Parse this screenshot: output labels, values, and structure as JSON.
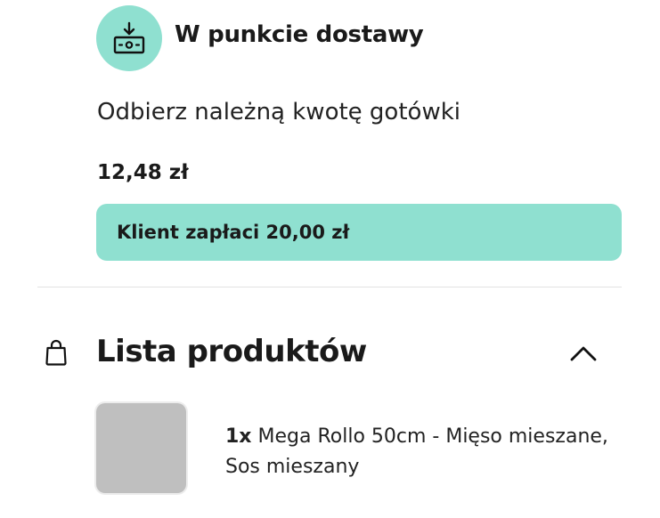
{
  "payment": {
    "icon": "cash-download-icon",
    "title": "W punkcie dostawy",
    "instruction": "Odbierz należną kwotę gotówki",
    "amount": "12,48 zł",
    "client_pays": "Klient zapłaci 20,00 zł"
  },
  "products": {
    "icon": "shopping-bag-icon",
    "title": "Lista produktów",
    "toggle_icon": "chevron-up-icon",
    "items": [
      {
        "quantity": "1x",
        "name": "Mega Rollo 50cm - Mięso mieszane, Sos mieszany"
      }
    ]
  },
  "colors": {
    "accent": "#8fe0d0",
    "thumbnail": "#bfbfbf"
  }
}
